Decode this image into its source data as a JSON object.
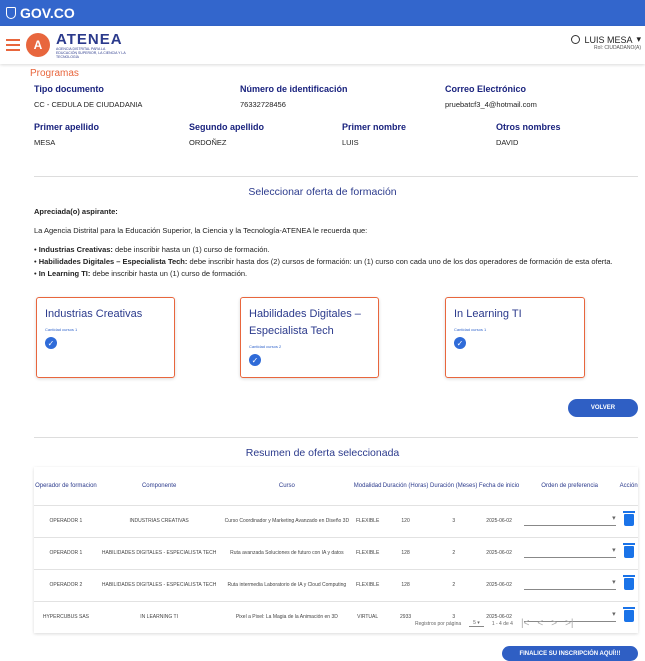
{
  "gov": {
    "label": "GOV.CO"
  },
  "app": {
    "name": "ATENEA",
    "subtitle": "AGENCIA DISTRITAL PARA LA EDUCACIÓN SUPERIOR, LA CIENCIA Y LA TECNOLOGÍA"
  },
  "user": {
    "name": "LUIS MESA",
    "role": "Rol: CIUDADANO(A)"
  },
  "section": "Programas",
  "fields": {
    "tipo_doc": {
      "label": "Tipo documento",
      "value": "CC - CEDULA DE CIUDADANIA"
    },
    "num_id": {
      "label": "Número de identificación",
      "value": "76332728456"
    },
    "correo": {
      "label": "Correo Electrónico",
      "value": "pruebatcf3_4@hotmail.com"
    },
    "ap1": {
      "label": "Primer apellido",
      "value": "MESA"
    },
    "ap2": {
      "label": "Segundo apellido",
      "value": "ORDOÑEZ"
    },
    "nom1": {
      "label": "Primer nombre",
      "value": "LUIS"
    },
    "nom2": {
      "label": "Otros nombres",
      "value": "DAVID"
    }
  },
  "offer": {
    "title": "Seleccionar oferta de formación",
    "greeting": "Apreciada(o) aspirante:",
    "intro": "La Agencia Distrital para la Educación Superior, la Ciencia y la Tecnología-ATENEA le recuerda que:",
    "bullets": [
      {
        "b": "Industrias Creativas:",
        "t": " debe inscribir hasta un (1) curso de formación."
      },
      {
        "b": "Habilidades Digitales – Especialista Tech:",
        "t": " debe inscribir hasta dos (2) cursos de formación: un (1) curso con cada uno de los dos operadores de formación de esta oferta."
      },
      {
        "b": "In Learning TI:",
        "t": " debe inscribir hasta un (1) curso de formación."
      }
    ],
    "cards": [
      {
        "title": "Industrias Creativas",
        "sub": "Cantidad cursos 1"
      },
      {
        "title": "Habilidades Digitales – Especialista Tech",
        "sub": "Cantidad cursos 2"
      },
      {
        "title": "In Learning TI",
        "sub": "Cantidad cursos 1"
      }
    ],
    "back": "VOLVER"
  },
  "summary": {
    "title": "Resumen de oferta seleccionada",
    "headers": [
      "Operador de formacion",
      "Componente",
      "Curso",
      "Modalidad",
      "Duración (Horas)",
      "Duración (Meses)",
      "Fecha de inicio",
      "Orden de preferencia",
      "Acción"
    ],
    "rows": [
      [
        "OPERADOR 1",
        "INDUSTRIAS CREATIVAS",
        "Curso Coordinador y Marketing Avanzado en Diseño 3D",
        "FLEXIBLE",
        "120",
        "3",
        "2025-06-02"
      ],
      [
        "OPERADOR 1",
        "HABILIDADES DIGITALES - ESPECIALISTA TECH",
        "Ruta avanzada Soluciones de futuro con IA y datos",
        "FLEXIBLE",
        "128",
        "2",
        "2025-06-02"
      ],
      [
        "OPERADOR 2",
        "HABILIDADES DIGITALES - ESPECIALISTA TECH",
        "Ruta intermedia Laboratorio de IA y Cloud Computing",
        "FLEXIBLE",
        "128",
        "2",
        "2025-06-02"
      ],
      [
        "HYPERCUBUS SAS",
        "IN LEARNING TI",
        "Pixel a Pixel: La Magia de la Animación en 3D",
        "VIRTUAL",
        "2933",
        "3",
        "2025-06-02"
      ]
    ],
    "pager": {
      "label": "Registros por página",
      "size": "5",
      "range": "1 - 4 de 4"
    },
    "finish": "FINALICE SU INSCRIPCIÓN AQUÍ!!!"
  }
}
